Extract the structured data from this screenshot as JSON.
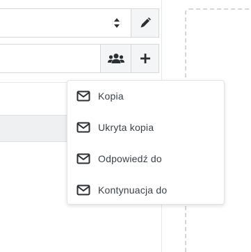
{
  "toolbar": {
    "edit_icon": "pencil-icon",
    "group_icon": "users-icon",
    "add_icon": "plus-icon",
    "sort_icon": "sort-arrows-icon"
  },
  "dropdown": {
    "items": [
      {
        "label": "Kopia",
        "icon": "envelope-icon"
      },
      {
        "label": "Ukryta kopia",
        "icon": "envelope-icon"
      },
      {
        "label": "Odpowiedź do",
        "icon": "envelope-icon"
      },
      {
        "label": "Kontynuacja do",
        "icon": "envelope-icon"
      }
    ]
  },
  "colors": {
    "text": "#3b4148",
    "icon": "#2b2f33",
    "border": "#d5d8dc",
    "button_bg": "#f4f5f6"
  }
}
